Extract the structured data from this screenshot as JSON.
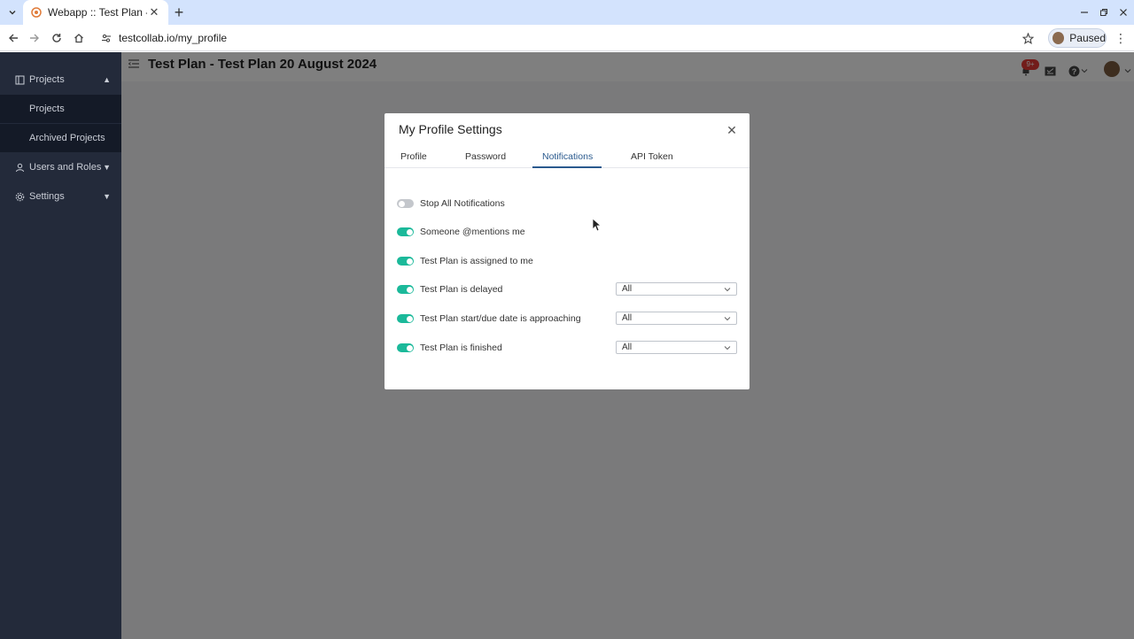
{
  "browser": {
    "tab_title": "Webapp :: Test Plan - Tes",
    "url": "testcollab.io/my_profile",
    "profile_label": "Paused"
  },
  "app": {
    "page_title": "Test Plan - Test Plan 20 August 2024",
    "notification_count": "9+",
    "sidebar": {
      "projects": "Projects",
      "projects_sub": "Projects",
      "archived_projects": "Archived Projects",
      "users_and_roles": "Users and Roles",
      "settings": "Settings"
    }
  },
  "modal": {
    "title": "My Profile Settings",
    "tabs": [
      {
        "label": "Profile"
      },
      {
        "label": "Password"
      },
      {
        "label": "Notifications",
        "active": true
      },
      {
        "label": "API Token"
      }
    ],
    "notifications": [
      {
        "label": "Stop All Notifications",
        "enabled": false
      },
      {
        "label": "Someone @mentions me",
        "enabled": true
      },
      {
        "label": "Test Plan is assigned to me",
        "enabled": true
      },
      {
        "label": "Test Plan is delayed",
        "enabled": true,
        "select": "All"
      },
      {
        "label": "Test Plan start/due date is approaching",
        "enabled": true,
        "select": "All"
      },
      {
        "label": "Test Plan is finished",
        "enabled": true,
        "select": "All"
      }
    ]
  },
  "colors": {
    "sidebar_bg": "#232a3a",
    "toggle_on": "#1bb99a",
    "active_tab": "#2a5a8e",
    "badge": "#e53935"
  }
}
